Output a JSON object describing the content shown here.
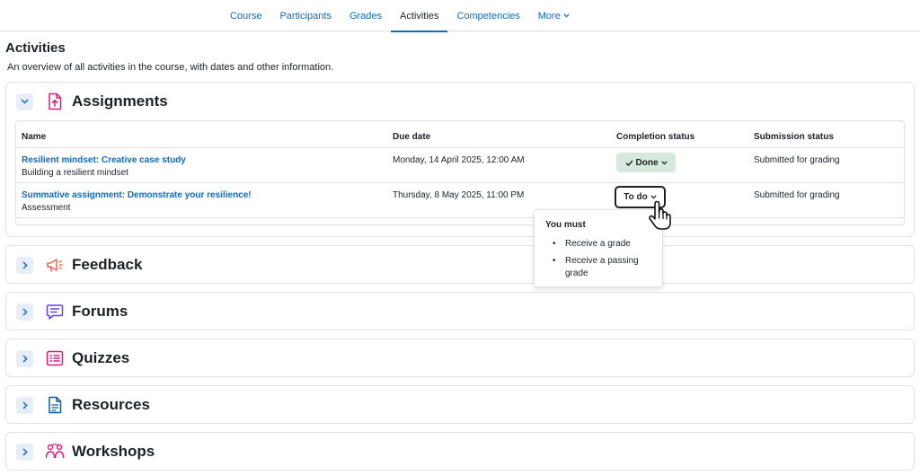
{
  "nav": {
    "tabs": [
      {
        "label": "Course"
      },
      {
        "label": "Participants"
      },
      {
        "label": "Grades"
      },
      {
        "label": "Activities"
      },
      {
        "label": "Competencies"
      },
      {
        "label": "More"
      }
    ],
    "active": "Activities"
  },
  "page": {
    "title": "Activities",
    "description": "An overview of all activities in the course, with dates and other information."
  },
  "sections": {
    "assignments": {
      "title": "Assignments",
      "icon": "assignment-upload-icon",
      "color": "#e3187b",
      "expanded": true,
      "table": {
        "headers": {
          "name": "Name",
          "due": "Due date",
          "completion": "Completion status",
          "submission": "Submission status"
        },
        "rows": [
          {
            "name": "Resilient mindset: Creative case study",
            "section": "Building a resilient mindset",
            "due": "Monday, 14 April 2025, 12:00 AM",
            "completion": "Done",
            "submission": "Submitted for grading"
          },
          {
            "name": "Summative assignment: Demonstrate your resilience!",
            "section": "Assessment",
            "due": "Thursday, 8 May 2025, 11:00 PM",
            "completion": "To do",
            "submission": "Submitted for grading"
          }
        ]
      }
    },
    "feedback": {
      "title": "Feedback",
      "icon": "megaphone-icon",
      "color": "#f7634d"
    },
    "forums": {
      "title": "Forums",
      "icon": "forum-chat-icon",
      "color": "#5b40ff"
    },
    "quizzes": {
      "title": "Quizzes",
      "icon": "quiz-list-icon",
      "color": "#e3187b"
    },
    "resources": {
      "title": "Resources",
      "icon": "document-icon",
      "color": "#0d5ca1"
    },
    "workshops": {
      "title": "Workshops",
      "icon": "workshop-people-icon",
      "color": "#e3187b"
    }
  },
  "popover": {
    "title": "You must",
    "items": [
      "Receive a grade",
      "Receive a passing grade"
    ]
  },
  "colors": {
    "link": "#0f6cbf",
    "done_bg": "#d7e9dc",
    "toggle_bg": "#e7eef7",
    "border": "#dee2e6"
  }
}
